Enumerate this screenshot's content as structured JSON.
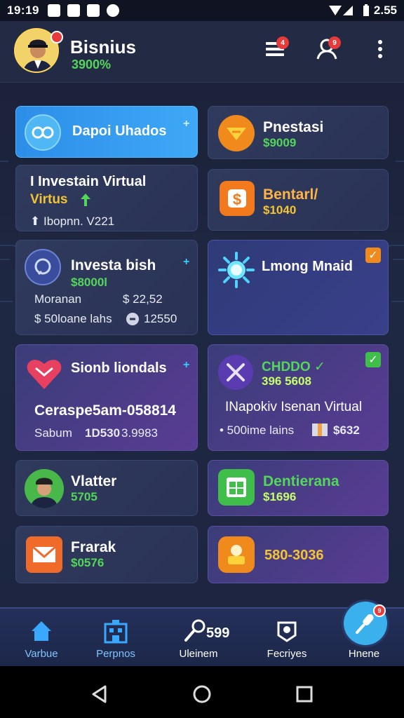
{
  "status_bar": {
    "time": "19:19",
    "battery": "2.55"
  },
  "header": {
    "title": "Bisnius",
    "amount": "3900%",
    "menu_badge": "4",
    "profile_badge": "9"
  },
  "cards": [
    {
      "title": "Dapoi Uhados",
      "variant": "blue",
      "plus": "+"
    },
    {
      "title": "Pnestasi",
      "value": "$9009"
    },
    {
      "line1": "I Investain Virtual",
      "line2": "Virtus",
      "line3": "⬆ Ibopnn. V221"
    },
    {
      "title": "Bentarl/",
      "value": "$1040"
    },
    {
      "title": "Investa bish",
      "value": "$8000l",
      "label_a": "Moranan",
      "value_a": "$ 22,52",
      "label_b": "$ 50loane lahs",
      "value_b": "12550",
      "plus": "+"
    },
    {
      "title": "Lmong Mnaid",
      "check": "✓"
    },
    {
      "title": "Sionb liondals",
      "headline": "Ceraspe5am-058814",
      "label": "Sabum",
      "value_cyan": "1D530",
      "value_white": "3.9983",
      "plus": "+"
    },
    {
      "title": "CHDDO ✓",
      "value": "396 5608",
      "headline": "INapokiv Isenan Virtual",
      "label": "• 500ime lains",
      "value_cyan": "$632",
      "check": "✓"
    },
    {
      "title": "Vlatter",
      "value": "5705"
    },
    {
      "title": "Dentierana",
      "value": "$1696"
    },
    {
      "title": "Frarak",
      "value": "$0576"
    },
    {
      "value": "580-3036"
    }
  ],
  "bottom_nav": [
    {
      "label": "Varbue"
    },
    {
      "label": "Perpnos"
    },
    {
      "label": "Uleinem",
      "value": "599"
    },
    {
      "label": "Fecriyes"
    },
    {
      "label": "Hnene"
    }
  ],
  "fab_badge": "9",
  "colors": {
    "accent_green": "#54d65a",
    "accent_cyan": "#2fd0ff",
    "badge_red": "#e53b3b",
    "card_blue": "#2d8ee8"
  }
}
